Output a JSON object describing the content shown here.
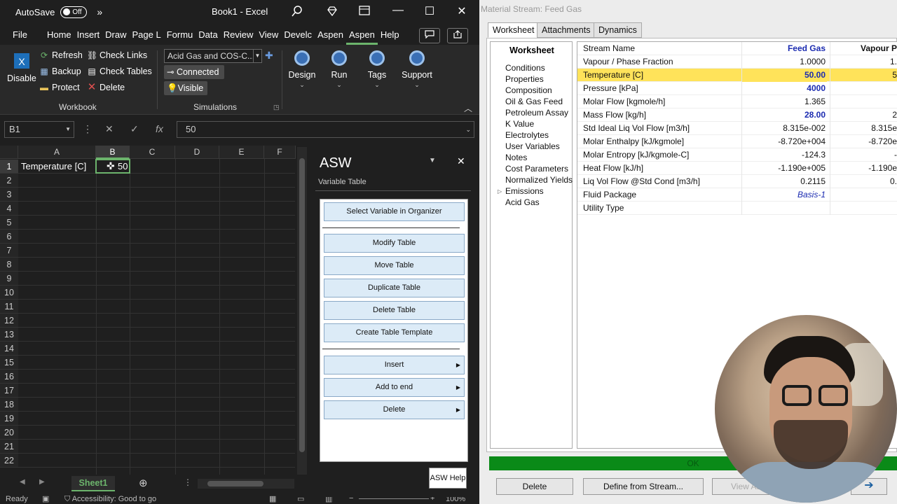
{
  "excel": {
    "autosave_label": "AutoSave",
    "autosave_state": "Off",
    "qat_more": "»",
    "doc_title": "Book1  -  Excel",
    "menu": [
      "File",
      "Home",
      "Insert",
      "Draw",
      "Page L",
      "Formu",
      "Data",
      "Review",
      "View",
      "Develc",
      "Aspen",
      "Aspen",
      "Help"
    ],
    "active_menu_index": 11,
    "ribbon": {
      "disable_label": "Disable",
      "refresh_label": "Refresh",
      "backup_label": "Backup",
      "protect_label": "Protect",
      "check_links_label": "Check Links",
      "check_tables_label": "Check Tables",
      "delete_label": "Delete",
      "simulation_combo": "Acid Gas and COS-C...",
      "connected_label": "Connected",
      "visible_label": "Visible",
      "design_label": "Design",
      "run_label": "Run",
      "tags_label": "Tags",
      "support_label": "Support",
      "group_workbook": "Workbook",
      "group_simulations": "Simulations"
    },
    "namebox": "B1",
    "formula_value": "50",
    "columns": [
      "A",
      "B",
      "C",
      "D",
      "E",
      "F"
    ],
    "rows": [
      "1",
      "2",
      "3",
      "4",
      "5",
      "6",
      "7",
      "8",
      "9",
      "10",
      "11",
      "12",
      "13",
      "14",
      "15",
      "16",
      "17",
      "18",
      "19",
      "20",
      "21",
      "22"
    ],
    "cell_a1": "Temperature [C]",
    "cell_b1": "50",
    "sheet_tab": "Sheet1",
    "status_ready": "Ready",
    "status_accessibility": "Accessibility: Good to go",
    "zoom": "100%"
  },
  "asw": {
    "title": "ASW",
    "subtitle": "Variable Table",
    "buttons": {
      "select_variable": "Select Variable in Organizer",
      "modify": "Modify Table",
      "move": "Move Table",
      "duplicate": "Duplicate Table",
      "delete_table": "Delete Table",
      "create_template": "Create Table Template",
      "insert": "Insert",
      "add_to_end": "Add to end",
      "delete": "Delete"
    },
    "help": "ASW Help"
  },
  "hysys": {
    "window_title": "Material Stream: Feed Gas",
    "tabs": [
      "Worksheet",
      "Attachments",
      "Dynamics"
    ],
    "nav_header": "Worksheet",
    "nav_items": [
      "Conditions",
      "Properties",
      "Composition",
      "Oil & Gas Feed",
      "Petroleum Assay",
      "K Value",
      "Electrolytes",
      "User Variables",
      "Notes",
      "Cost Parameters",
      "Normalized Yields",
      "Emissions",
      "Acid Gas"
    ],
    "table": [
      {
        "label": "Stream Name",
        "v1": "Feed Gas",
        "v2": "Vapour P"
      },
      {
        "label": "Vapour / Phase Fraction",
        "v1": "1.0000",
        "v2": "1."
      },
      {
        "label": "Temperature [C]",
        "v1": "50.00",
        "v2": "5"
      },
      {
        "label": "Pressure [kPa]",
        "v1": "4000",
        "v2": ""
      },
      {
        "label": "Molar Flow [kgmole/h]",
        "v1": "1.365",
        "v2": ""
      },
      {
        "label": "Mass Flow [kg/h]",
        "v1": "28.00",
        "v2": "2"
      },
      {
        "label": "Std Ideal Liq Vol Flow [m3/h]",
        "v1": "8.315e-002",
        "v2": "8.315e"
      },
      {
        "label": "Molar Enthalpy [kJ/kgmole]",
        "v1": "-8.720e+004",
        "v2": "-8.720e"
      },
      {
        "label": "Molar Entropy [kJ/kgmole-C]",
        "v1": "-124.3",
        "v2": "-"
      },
      {
        "label": "Heat Flow [kJ/h]",
        "v1": "-1.190e+005",
        "v2": "-1.190e"
      },
      {
        "label": "Liq Vol Flow @Std Cond [m3/h]",
        "v1": "0.2115",
        "v2": "0."
      },
      {
        "label": "Fluid Package",
        "v1": "Basis-1",
        "v2": ""
      },
      {
        "label": "Utility Type",
        "v1": "",
        "v2": ""
      }
    ],
    "status": "OK",
    "btn_delete": "Delete",
    "btn_define": "Define from Stream...",
    "btn_view": "View As"
  }
}
